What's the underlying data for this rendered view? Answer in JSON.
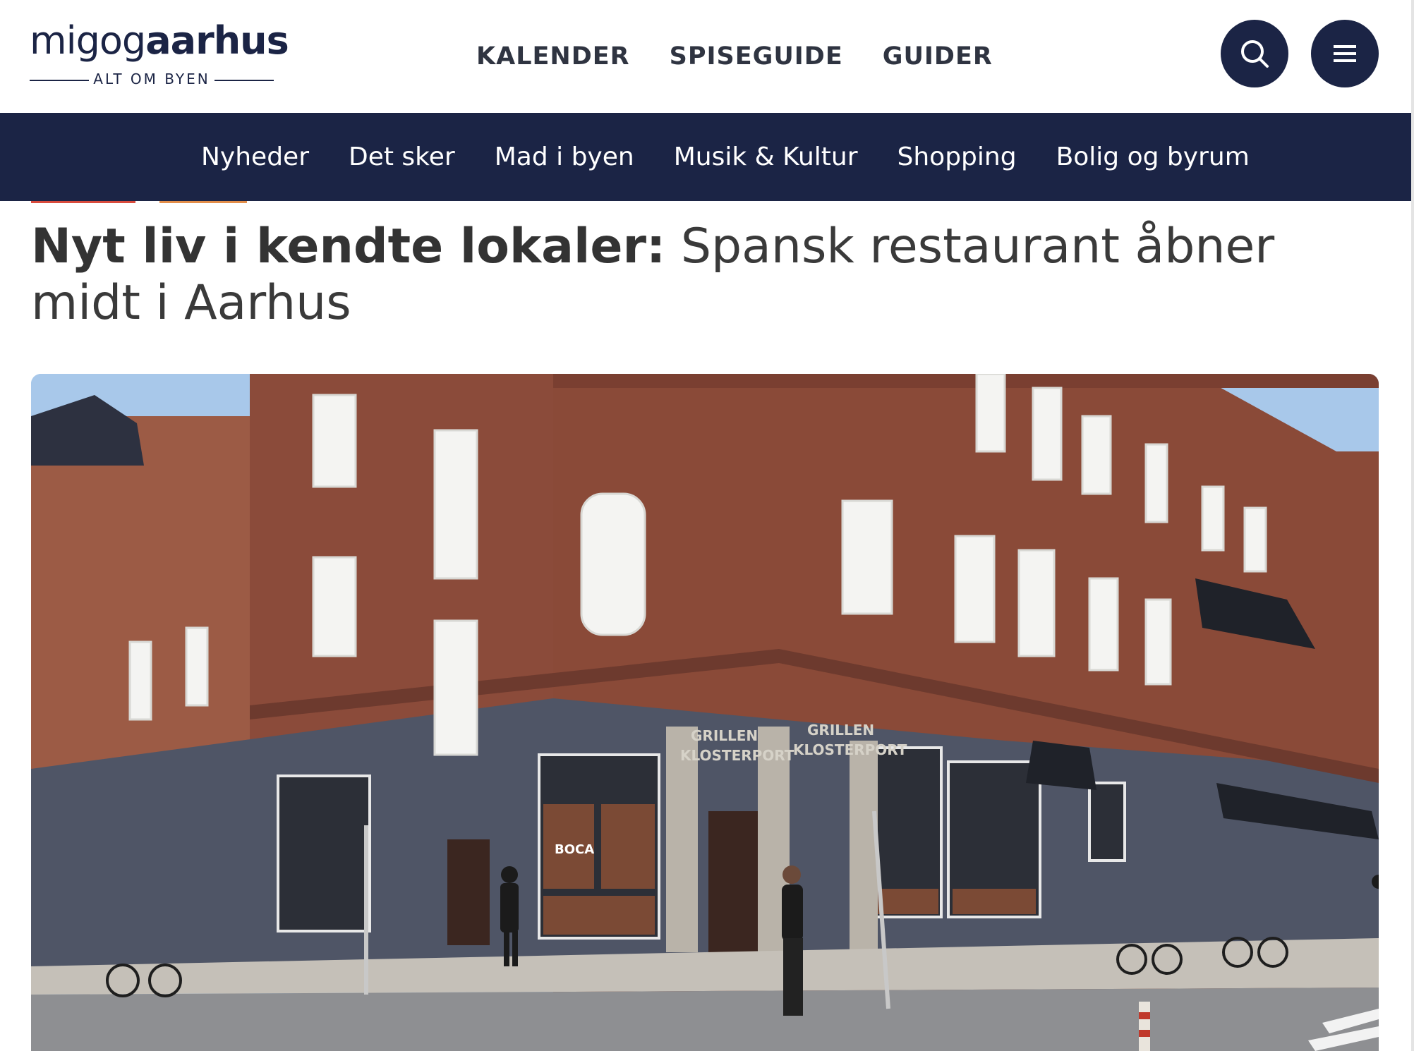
{
  "site": {
    "logo_part1": "migog",
    "logo_part2": "aarhus",
    "tagline": "ALT OM BYEN"
  },
  "main_nav": [
    {
      "label": "KALENDER"
    },
    {
      "label": "SPISEGUIDE"
    },
    {
      "label": "GUIDER"
    }
  ],
  "header_icons": {
    "search": "search-icon",
    "menu": "hamburger-menu-icon"
  },
  "category_nav": [
    {
      "label": "Nyheder"
    },
    {
      "label": "Det sker"
    },
    {
      "label": "Mad i byen"
    },
    {
      "label": "Musik & Kultur"
    },
    {
      "label": "Shopping"
    },
    {
      "label": "Bolig og byrum"
    }
  ],
  "article": {
    "kicker": "Nyt liv i kendte lokaler:",
    "title": "Spansk restaurant åbner midt i Aarhus"
  },
  "hero_image": {
    "sign_left_line1": "GRILLEN",
    "sign_left_line2": "KLOSTERPORT",
    "sign_right_line1": "GRILLEN",
    "sign_right_line2": "KLOSTERPORT",
    "window_logo": "BOCA"
  },
  "colors": {
    "navy": "#1b2445",
    "tag_red": "#d94b3d",
    "tag_orange": "#e38e4a",
    "brick": "#8a4a38",
    "facade_grey": "#4f5566"
  }
}
